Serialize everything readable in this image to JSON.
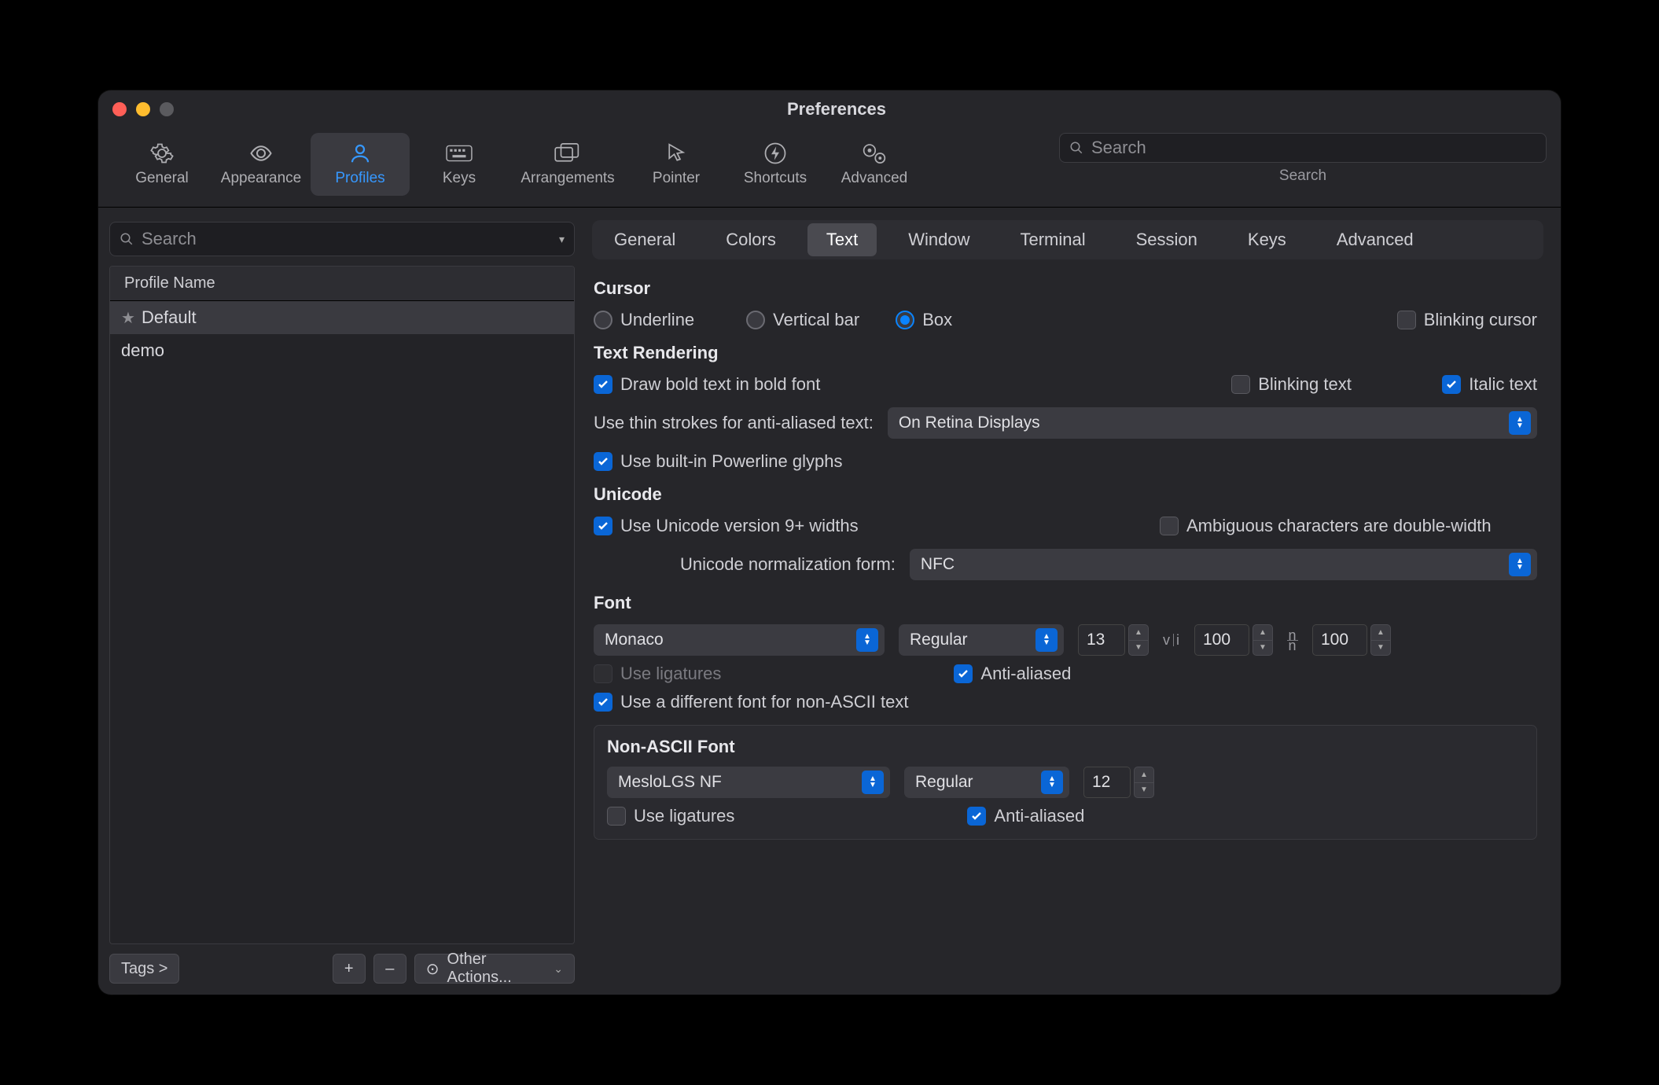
{
  "window": {
    "title": "Preferences"
  },
  "toolbar": {
    "items": [
      {
        "id": "general",
        "label": "General"
      },
      {
        "id": "appearance",
        "label": "Appearance"
      },
      {
        "id": "profiles",
        "label": "Profiles"
      },
      {
        "id": "keys",
        "label": "Keys"
      },
      {
        "id": "arrangements",
        "label": "Arrangements"
      },
      {
        "id": "pointer",
        "label": "Pointer"
      },
      {
        "id": "shortcuts",
        "label": "Shortcuts"
      },
      {
        "id": "advanced",
        "label": "Advanced"
      }
    ],
    "selected": "profiles",
    "search_placeholder": "Search",
    "search_label": "Search"
  },
  "sidebar": {
    "search_placeholder": "Search",
    "header": "Profile Name",
    "profiles": [
      {
        "name": "Default",
        "starred": true,
        "selected": true
      },
      {
        "name": "demo",
        "starred": false,
        "selected": false
      }
    ],
    "tags_label": "Tags >",
    "add_label": "+",
    "remove_label": "–",
    "other_actions_label": "Other Actions..."
  },
  "tabs": {
    "items": [
      "General",
      "Colors",
      "Text",
      "Window",
      "Terminal",
      "Session",
      "Keys",
      "Advanced"
    ],
    "selected": "Text"
  },
  "cursor": {
    "heading": "Cursor",
    "underline": "Underline",
    "vertical": "Vertical bar",
    "box": "Box",
    "selected": "box",
    "blinking": "Blinking cursor",
    "blinking_on": false
  },
  "text_rendering": {
    "heading": "Text Rendering",
    "draw_bold": "Draw bold text in bold font",
    "draw_bold_on": true,
    "blinking_text": "Blinking text",
    "blinking_text_on": false,
    "italic": "Italic text",
    "italic_on": true,
    "thin_strokes_label": "Use thin strokes for anti-aliased text:",
    "thin_strokes_value": "On Retina Displays",
    "powerline": "Use built-in Powerline glyphs",
    "powerline_on": true
  },
  "unicode": {
    "heading": "Unicode",
    "v9": "Use Unicode version 9+ widths",
    "v9_on": true,
    "ambiguous": "Ambiguous characters are double-width",
    "ambiguous_on": false,
    "norm_label": "Unicode normalization form:",
    "norm_value": "NFC"
  },
  "font": {
    "heading": "Font",
    "family": "Monaco",
    "style": "Regular",
    "size": "13",
    "hspacing": "100",
    "vspacing": "100",
    "ligatures": "Use ligatures",
    "ligatures_on": false,
    "ligatures_disabled": true,
    "anti_aliased": "Anti-aliased",
    "anti_aliased_on": true,
    "diff_font": "Use a different font for non-ASCII text",
    "diff_font_on": true
  },
  "non_ascii": {
    "heading": "Non-ASCII Font",
    "family": "MesloLGS NF",
    "style": "Regular",
    "size": "12",
    "ligatures": "Use ligatures",
    "ligatures_on": false,
    "anti_aliased": "Anti-aliased",
    "anti_aliased_on": true
  }
}
